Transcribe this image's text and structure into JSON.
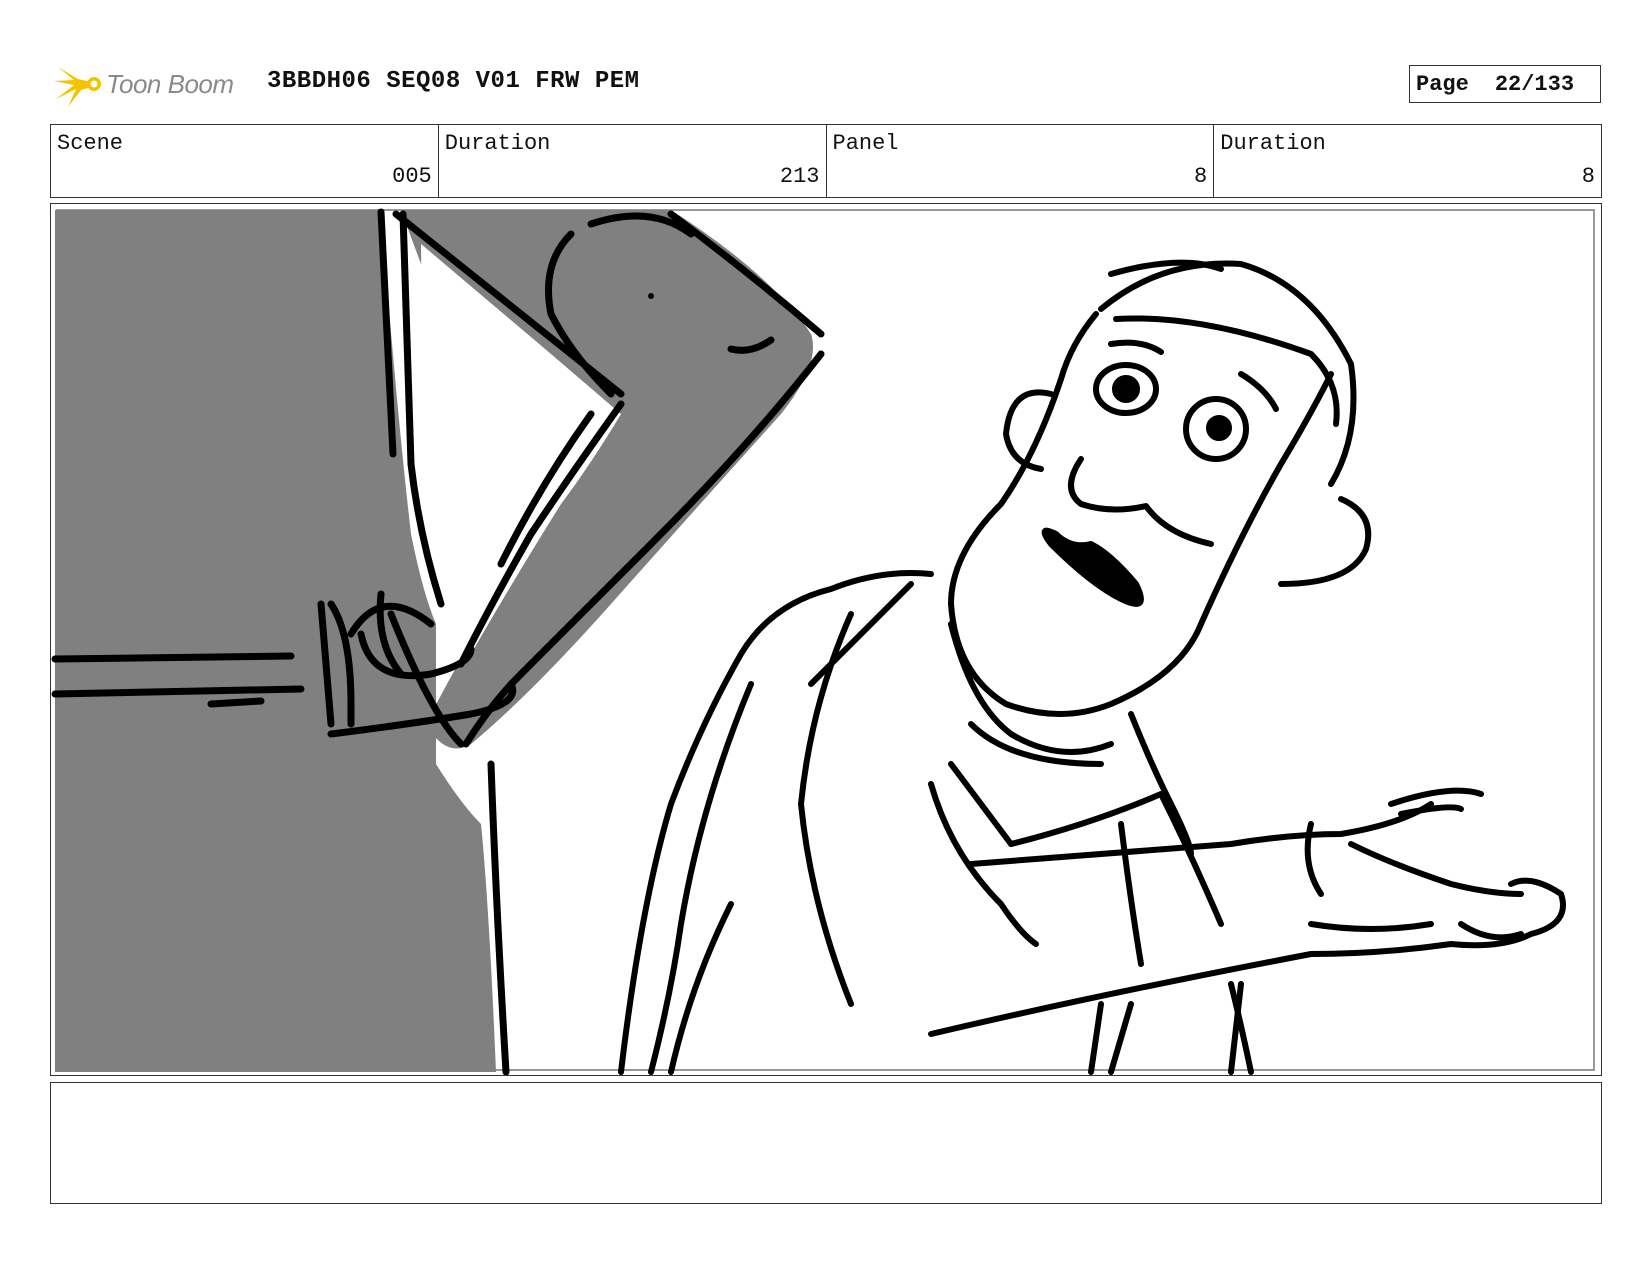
{
  "header": {
    "logo_text": "Toon Boom",
    "logo_icon": "toon-boom-burst-icon",
    "title": "3BBDH06 SEQ08 V01 FRW PEM",
    "page_label": "Page",
    "page_value": "22/133"
  },
  "info": {
    "scene_label": "Scene",
    "scene_value": "005",
    "scene_duration_label": "Duration",
    "scene_duration_value": "213",
    "panel_label": "Panel",
    "panel_value": "8",
    "panel_duration_label": "Duration",
    "panel_duration_value": "8"
  },
  "colors": {
    "logo_yellow": "#f5c400",
    "logo_gray": "#8a8a8a",
    "foreground_character_fill": "#808080",
    "line": "#000000"
  },
  "notes": {
    "text": ""
  }
}
